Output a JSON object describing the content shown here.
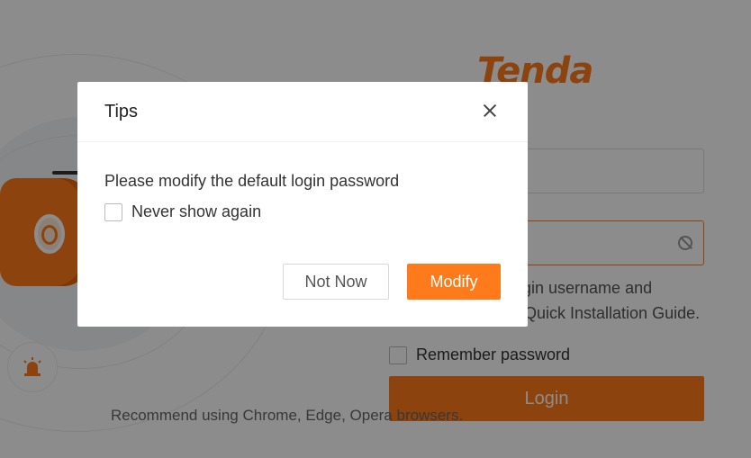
{
  "brand": {
    "logo_text": "Tenda",
    "accent": "#ff7a1a"
  },
  "login_page": {
    "hint_line1": "gin username and",
    "hint_line2": "Quick Installation Guide.",
    "remember_label": "Remember password",
    "login_button": "Login",
    "recommend_text": "Recommend using Chrome, Edge, Opera browsers."
  },
  "dialog": {
    "title": "Tips",
    "message": "Please modify the default login password",
    "checkbox_label": "Never show again",
    "checkbox_checked": false,
    "secondary_button": "Not Now",
    "primary_button": "Modify"
  },
  "icons": [
    "close-icon",
    "eye-off-icon",
    "camera-illustration",
    "siren-icon"
  ]
}
